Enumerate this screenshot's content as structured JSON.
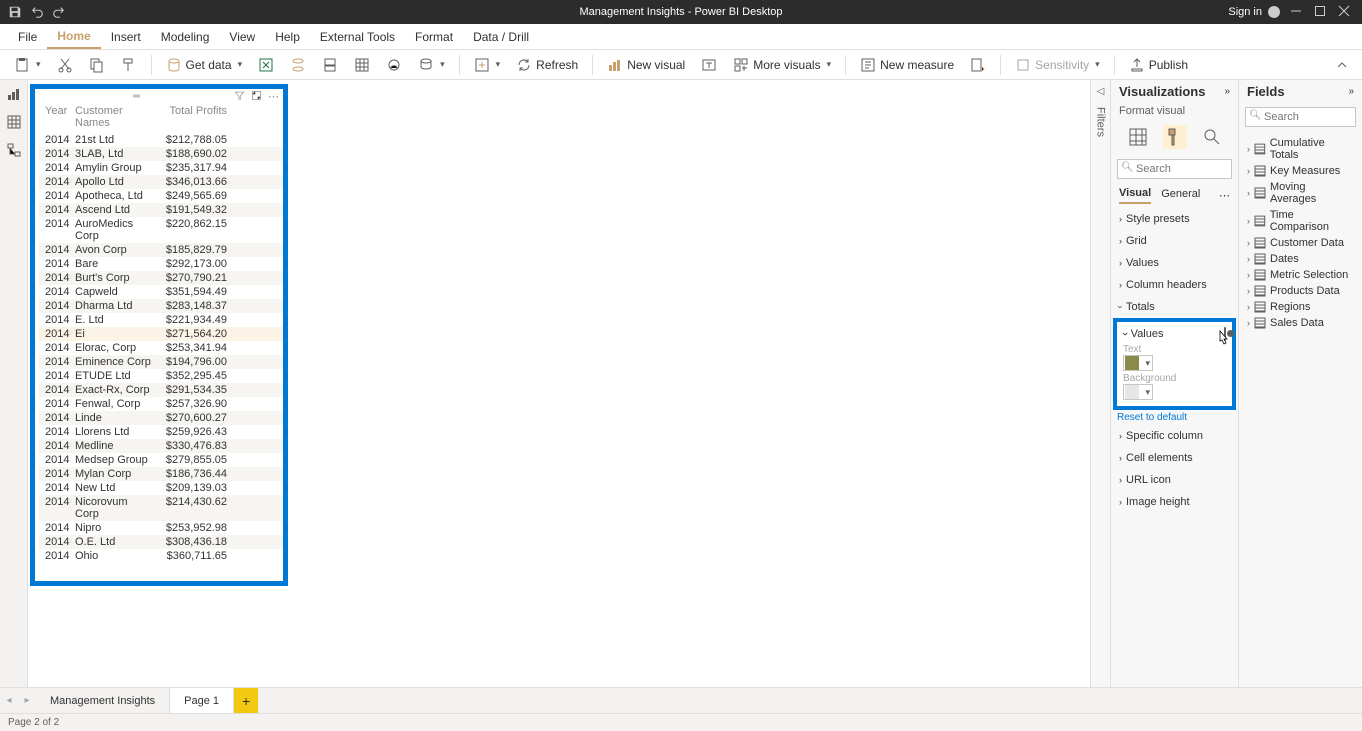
{
  "app": {
    "title": "Management Insights - Power BI Desktop",
    "signin": "Sign in"
  },
  "menu": {
    "file": "File",
    "home": "Home",
    "insert": "Insert",
    "modeling": "Modeling",
    "view": "View",
    "help": "Help",
    "external": "External Tools",
    "format": "Format",
    "data_drill": "Data / Drill"
  },
  "ribbon": {
    "get_data": "Get data",
    "refresh": "Refresh",
    "new_visual": "New visual",
    "more_visuals": "More visuals",
    "new_measure": "New measure",
    "sensitivity": "Sensitivity",
    "publish": "Publish"
  },
  "filters_label": "Filters",
  "viz": {
    "title": "Visualizations",
    "sub": "Format visual",
    "search_placeholder": "Search",
    "tab_visual": "Visual",
    "tab_general": "General",
    "style_presets": "Style presets",
    "grid": "Grid",
    "values": "Values",
    "column_headers": "Column headers",
    "totals": "Totals",
    "totals_values": "Values",
    "text": "Text",
    "background": "Background",
    "reset": "Reset to default",
    "specific_col": "Specific column",
    "cell_elements": "Cell elements",
    "url_icon": "URL icon",
    "image_height": "Image height",
    "colors": {
      "text": "#8a8a4a",
      "bg": "#e6e6e6"
    }
  },
  "fields": {
    "title": "Fields",
    "search_placeholder": "Search",
    "items": [
      "Cumulative Totals",
      "Key Measures",
      "Moving Averages",
      "Time Comparison",
      "Customer Data",
      "Dates",
      "Metric Selection",
      "Products Data",
      "Regions",
      "Sales Data"
    ]
  },
  "table": {
    "headers": {
      "year": "Year",
      "name": "Customer Names",
      "profit": "Total Profits"
    },
    "rows": [
      {
        "y": "2014",
        "n": "21st Ltd",
        "p": "$212,788.05"
      },
      {
        "y": "2014",
        "n": "3LAB, Ltd",
        "p": "$188,690.02"
      },
      {
        "y": "2014",
        "n": "Amylin Group",
        "p": "$235,317.94"
      },
      {
        "y": "2014",
        "n": "Apollo Ltd",
        "p": "$346,013.66"
      },
      {
        "y": "2014",
        "n": "Apotheca, Ltd",
        "p": "$249,565.69"
      },
      {
        "y": "2014",
        "n": "Ascend Ltd",
        "p": "$191,549.32"
      },
      {
        "y": "2014",
        "n": "AuroMedics Corp",
        "p": "$220,862.15"
      },
      {
        "y": "2014",
        "n": "Avon Corp",
        "p": "$185,829.79"
      },
      {
        "y": "2014",
        "n": "Bare",
        "p": "$292,173.00"
      },
      {
        "y": "2014",
        "n": "Burt's Corp",
        "p": "$270,790.21"
      },
      {
        "y": "2014",
        "n": "Capweld",
        "p": "$351,594.49"
      },
      {
        "y": "2014",
        "n": "Dharma Ltd",
        "p": "$283,148.37"
      },
      {
        "y": "2014",
        "n": "E. Ltd",
        "p": "$221,934.49"
      },
      {
        "y": "2014",
        "n": "Ei",
        "p": "$271,564.20",
        "hl": true
      },
      {
        "y": "2014",
        "n": "Elorac, Corp",
        "p": "$253,341.94"
      },
      {
        "y": "2014",
        "n": "Eminence Corp",
        "p": "$194,796.00"
      },
      {
        "y": "2014",
        "n": "ETUDE Ltd",
        "p": "$352,295.45"
      },
      {
        "y": "2014",
        "n": "Exact-Rx, Corp",
        "p": "$291,534.35"
      },
      {
        "y": "2014",
        "n": "Fenwal, Corp",
        "p": "$257,326.90"
      },
      {
        "y": "2014",
        "n": "Linde",
        "p": "$270,600.27"
      },
      {
        "y": "2014",
        "n": "Llorens Ltd",
        "p": "$259,926.43"
      },
      {
        "y": "2014",
        "n": "Medline",
        "p": "$330,476.83"
      },
      {
        "y": "2014",
        "n": "Medsep Group",
        "p": "$279,855.05"
      },
      {
        "y": "2014",
        "n": "Mylan Corp",
        "p": "$186,736.44"
      },
      {
        "y": "2014",
        "n": "New Ltd",
        "p": "$209,139.03"
      },
      {
        "y": "2014",
        "n": "Nicorovum Corp",
        "p": "$214,430.62"
      },
      {
        "y": "2014",
        "n": "Nipro",
        "p": "$253,952.98"
      },
      {
        "y": "2014",
        "n": "O.E. Ltd",
        "p": "$308,436.18"
      },
      {
        "y": "2014",
        "n": "Ohio",
        "p": "$360,711.65"
      }
    ]
  },
  "pages": {
    "tab1": "Management Insights",
    "tab2": "Page 1"
  },
  "status": "Page 2 of 2"
}
